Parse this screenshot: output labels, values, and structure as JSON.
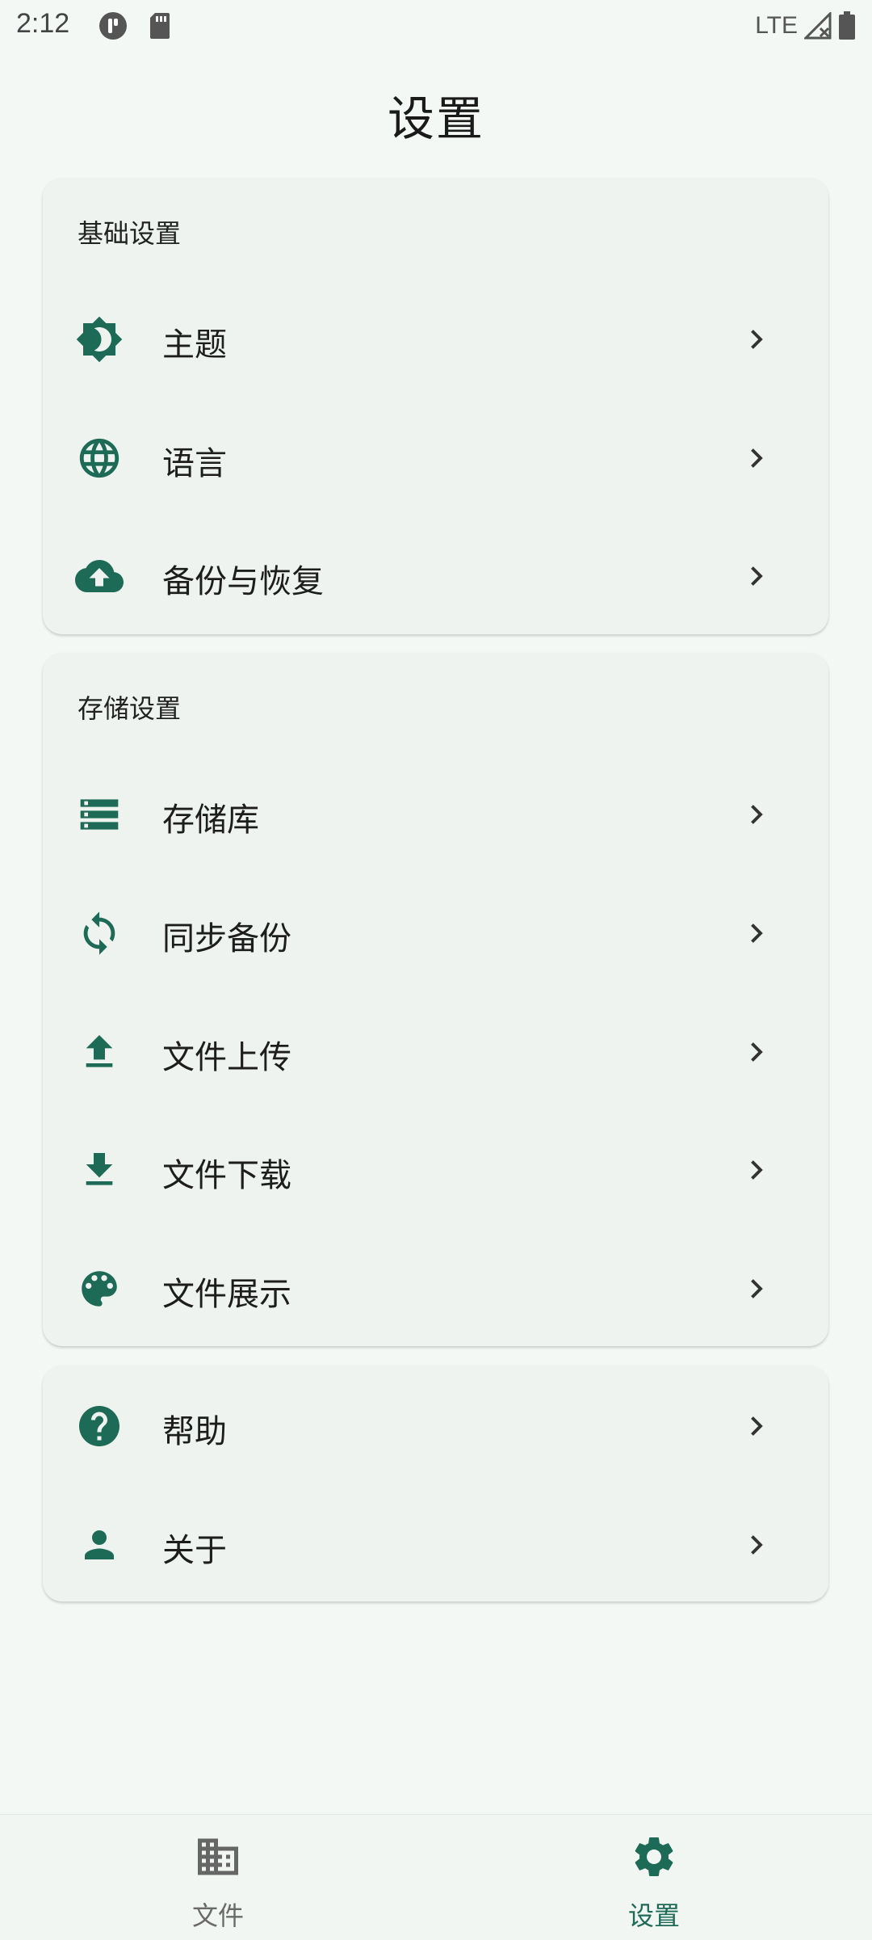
{
  "status_bar": {
    "time": "2:12",
    "network": "LTE"
  },
  "header": {
    "title": "设置"
  },
  "colors": {
    "accent": "#1d6b56",
    "background": "#f4f8f5",
    "card": "#eef3ef"
  },
  "basic_settings": {
    "title": "基础设置",
    "items": [
      {
        "label": "主题",
        "icon": "brightness-icon"
      },
      {
        "label": "语言",
        "icon": "globe-icon"
      },
      {
        "label": "备份与恢复",
        "icon": "cloud-upload-icon"
      }
    ]
  },
  "storage_settings": {
    "title": "存储设置",
    "items": [
      {
        "label": "存储库",
        "icon": "storage-icon"
      },
      {
        "label": "同步备份",
        "icon": "sync-icon"
      },
      {
        "label": "文件上传",
        "icon": "upload-icon"
      },
      {
        "label": "文件下载",
        "icon": "download-icon"
      },
      {
        "label": "文件展示",
        "icon": "palette-icon"
      }
    ]
  },
  "other": {
    "items": [
      {
        "label": "帮助",
        "icon": "help-icon"
      },
      {
        "label": "关于",
        "icon": "person-icon"
      }
    ]
  },
  "bottom_nav": {
    "items": [
      {
        "label": "文件",
        "icon": "building-icon",
        "active": false
      },
      {
        "label": "设置",
        "icon": "gear-icon",
        "active": true
      }
    ]
  }
}
